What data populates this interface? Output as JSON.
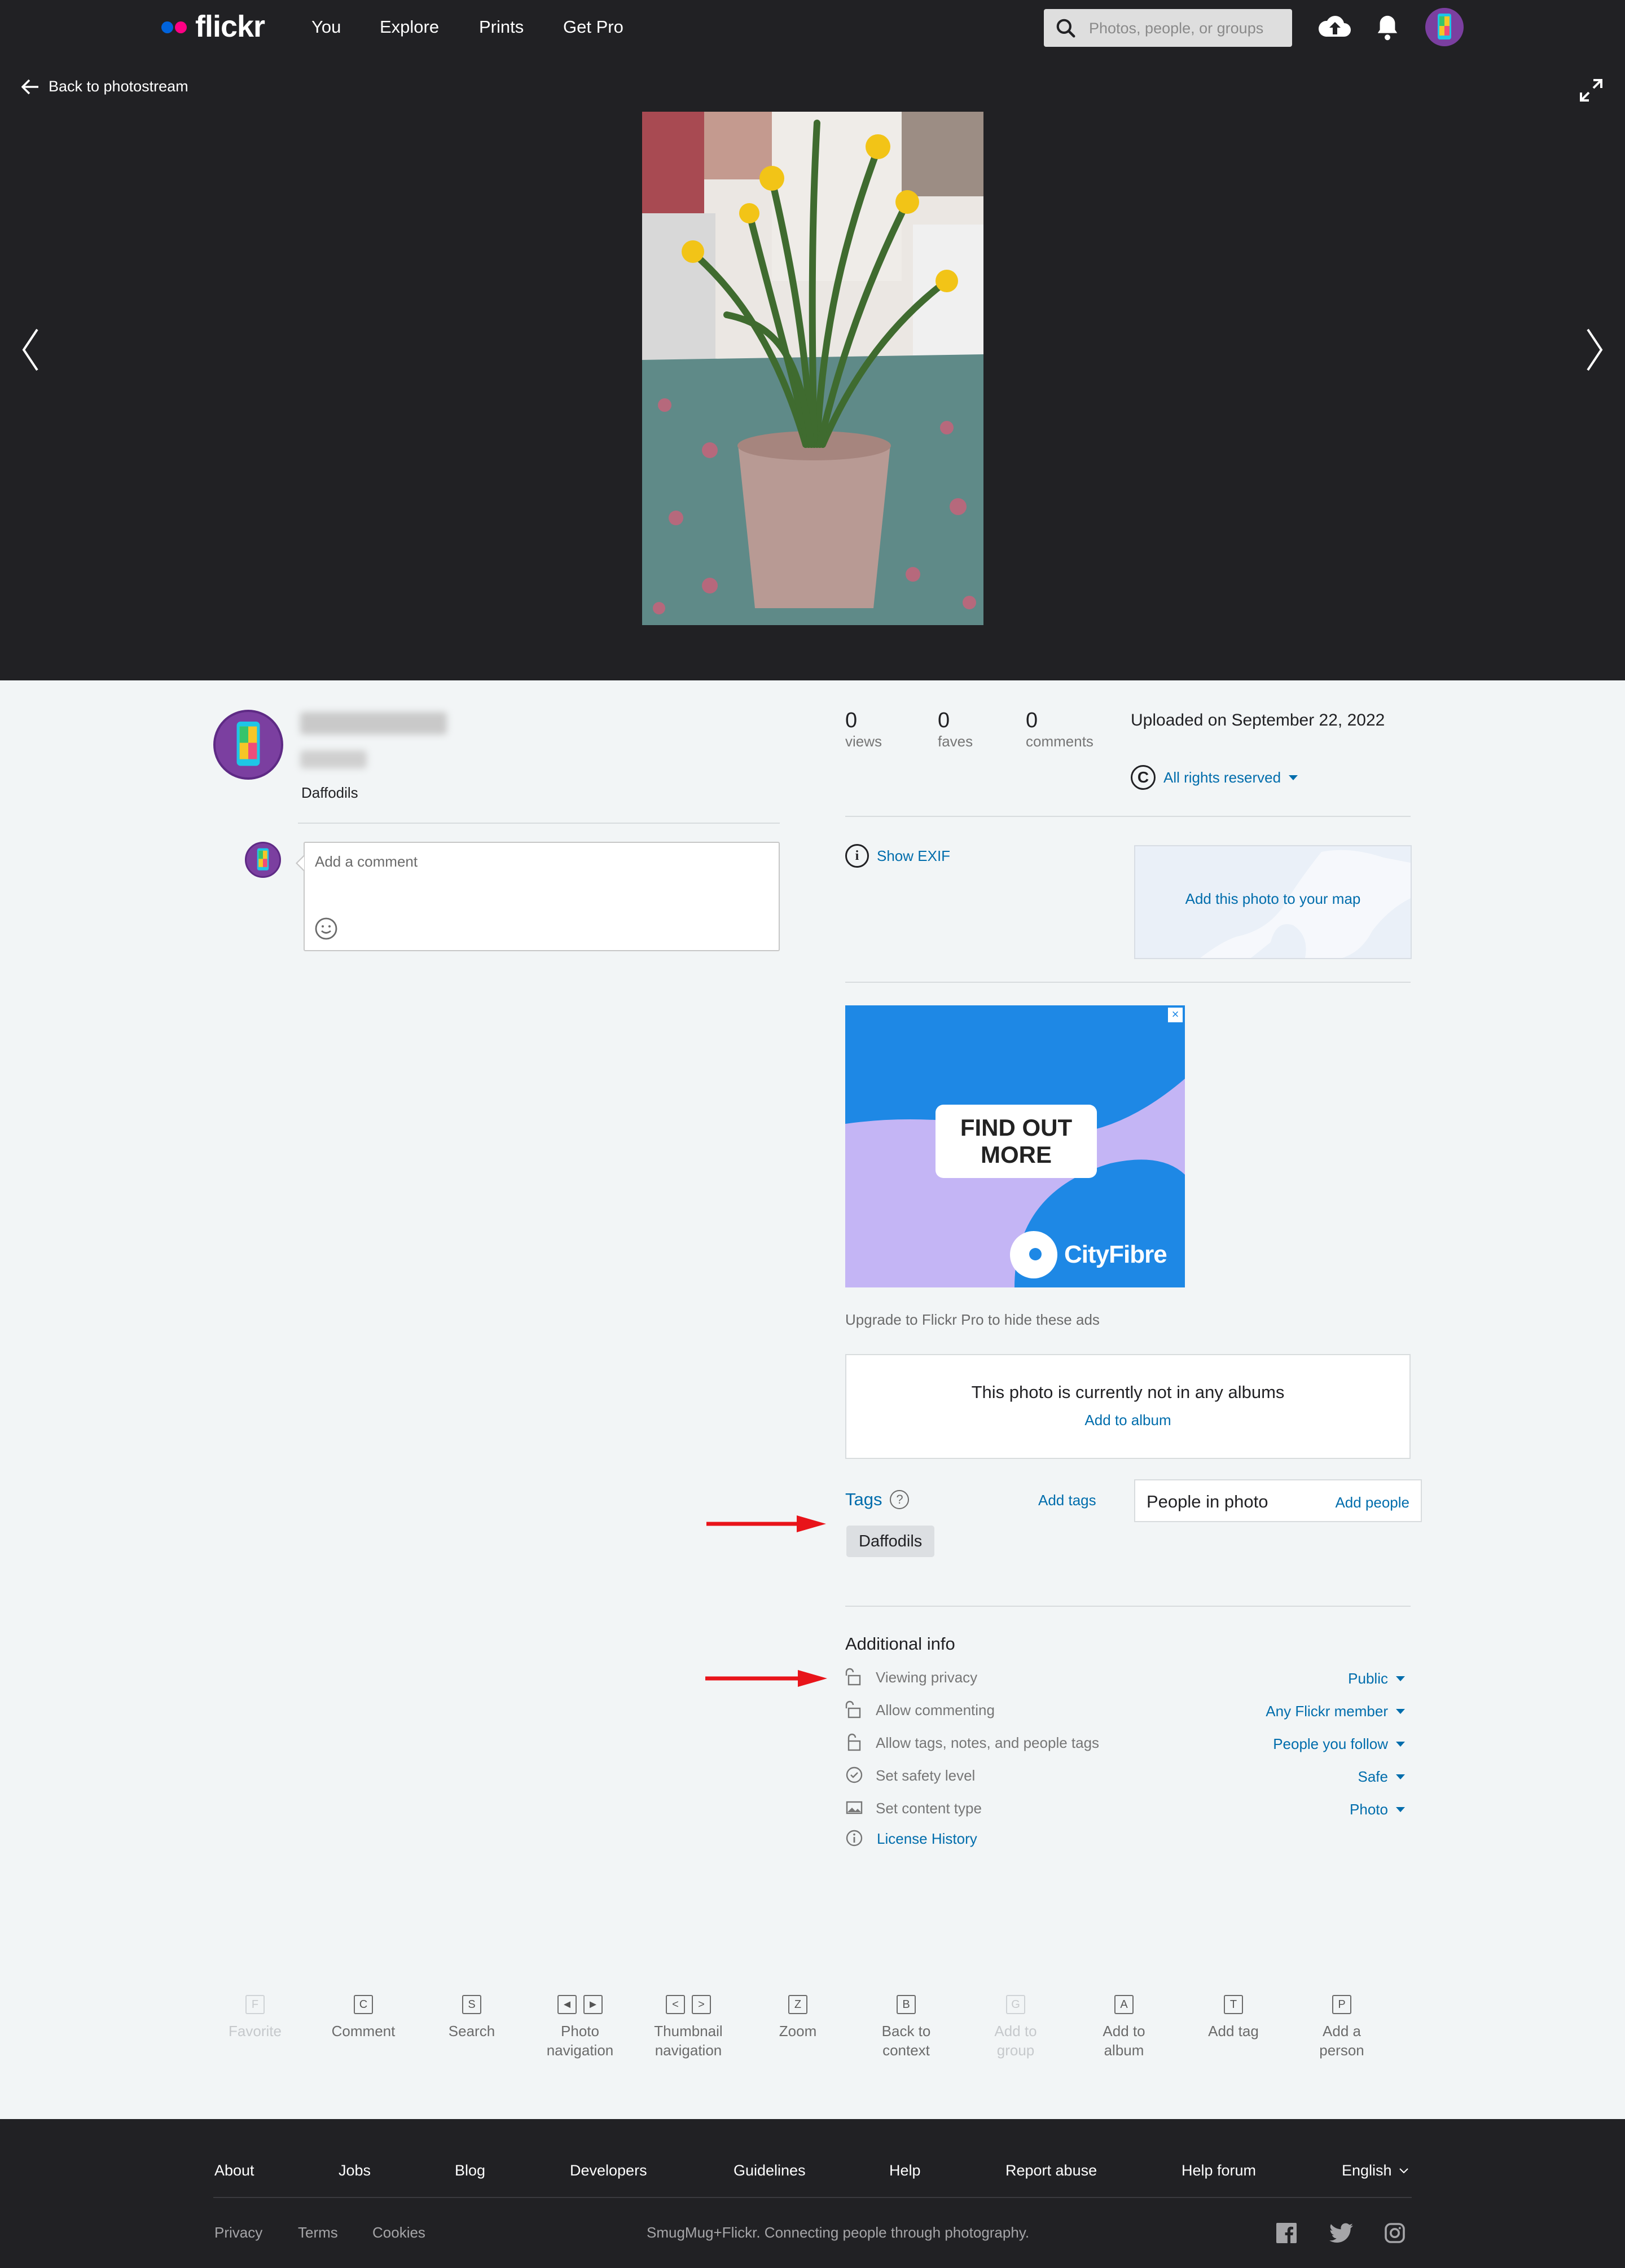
{
  "nav": {
    "logo": "flickr",
    "links": [
      "You",
      "Explore",
      "Prints",
      "Get Pro"
    ],
    "search_placeholder": "Photos, people, or groups",
    "colors": {
      "logo_blue": "#0063dc",
      "logo_pink": "#ff0084"
    }
  },
  "photo_view": {
    "back_label": "Back to photostream"
  },
  "owner": {
    "photo_title": "Daffodils"
  },
  "comment": {
    "placeholder": "Add a comment"
  },
  "stats": {
    "views": {
      "value": "0",
      "label": "views"
    },
    "faves": {
      "value": "0",
      "label": "faves"
    },
    "comments": {
      "value": "0",
      "label": "comments"
    },
    "uploaded": "Uploaded on September 22, 2022",
    "rights": "All rights reserved"
  },
  "exif": {
    "label": "Show EXIF",
    "map_label": "Add this photo to your map"
  },
  "ad": {
    "button_line1": "FIND OUT",
    "button_line2": "MORE",
    "brand": "CityFibre",
    "upgrade": "Upgrade to Flickr Pro to hide these ads"
  },
  "albums": {
    "message": "This photo is currently not in any albums",
    "action": "Add to album"
  },
  "tags": {
    "title": "Tags",
    "add": "Add tags",
    "items": [
      "Daffodils"
    ]
  },
  "people": {
    "title": "People in photo",
    "add": "Add people"
  },
  "additional_info": {
    "title": "Additional info",
    "rows": [
      {
        "label": "Viewing privacy",
        "value": "Public",
        "icon": "lock-open-icon"
      },
      {
        "label": "Allow commenting",
        "value": "Any Flickr member",
        "icon": "lock-open-icon"
      },
      {
        "label": "Allow tags, notes, and people tags",
        "value": "People you follow",
        "icon": "lock-icon"
      },
      {
        "label": "Set safety level",
        "value": "Safe",
        "icon": "check-circle-icon"
      },
      {
        "label": "Set content type",
        "value": "Photo",
        "icon": "image-icon"
      }
    ],
    "license_history": "License History"
  },
  "shortcuts": [
    {
      "keys": [
        "F"
      ],
      "label1": "Favorite",
      "label2": "",
      "dim": true
    },
    {
      "keys": [
        "C"
      ],
      "label1": "Comment",
      "label2": "",
      "dim": false
    },
    {
      "keys": [
        "S"
      ],
      "label1": "Search",
      "label2": "",
      "dim": false
    },
    {
      "keys": [
        "◄",
        "►"
      ],
      "label1": "Photo",
      "label2": "navigation",
      "dim": false
    },
    {
      "keys": [
        "<",
        ">"
      ],
      "label1": "Thumbnail",
      "label2": "navigation",
      "dim": false
    },
    {
      "keys": [
        "Z"
      ],
      "label1": "Zoom",
      "label2": "",
      "dim": false
    },
    {
      "keys": [
        "B"
      ],
      "label1": "Back to",
      "label2": "context",
      "dim": false
    },
    {
      "keys": [
        "G"
      ],
      "label1": "Add to",
      "label2": "group",
      "dim": true
    },
    {
      "keys": [
        "A"
      ],
      "label1": "Add to",
      "label2": "album",
      "dim": false
    },
    {
      "keys": [
        "T"
      ],
      "label1": "Add tag",
      "label2": "",
      "dim": false
    },
    {
      "keys": [
        "P"
      ],
      "label1": "Add a",
      "label2": "person",
      "dim": false
    }
  ],
  "footer": {
    "links": [
      "About",
      "Jobs",
      "Blog",
      "Developers",
      "Guidelines",
      "Help",
      "Report abuse",
      "Help forum"
    ],
    "language": "English",
    "legal": [
      "Privacy",
      "Terms",
      "Cookies"
    ],
    "tagline": "SmugMug+Flickr. Connecting people through photography."
  }
}
